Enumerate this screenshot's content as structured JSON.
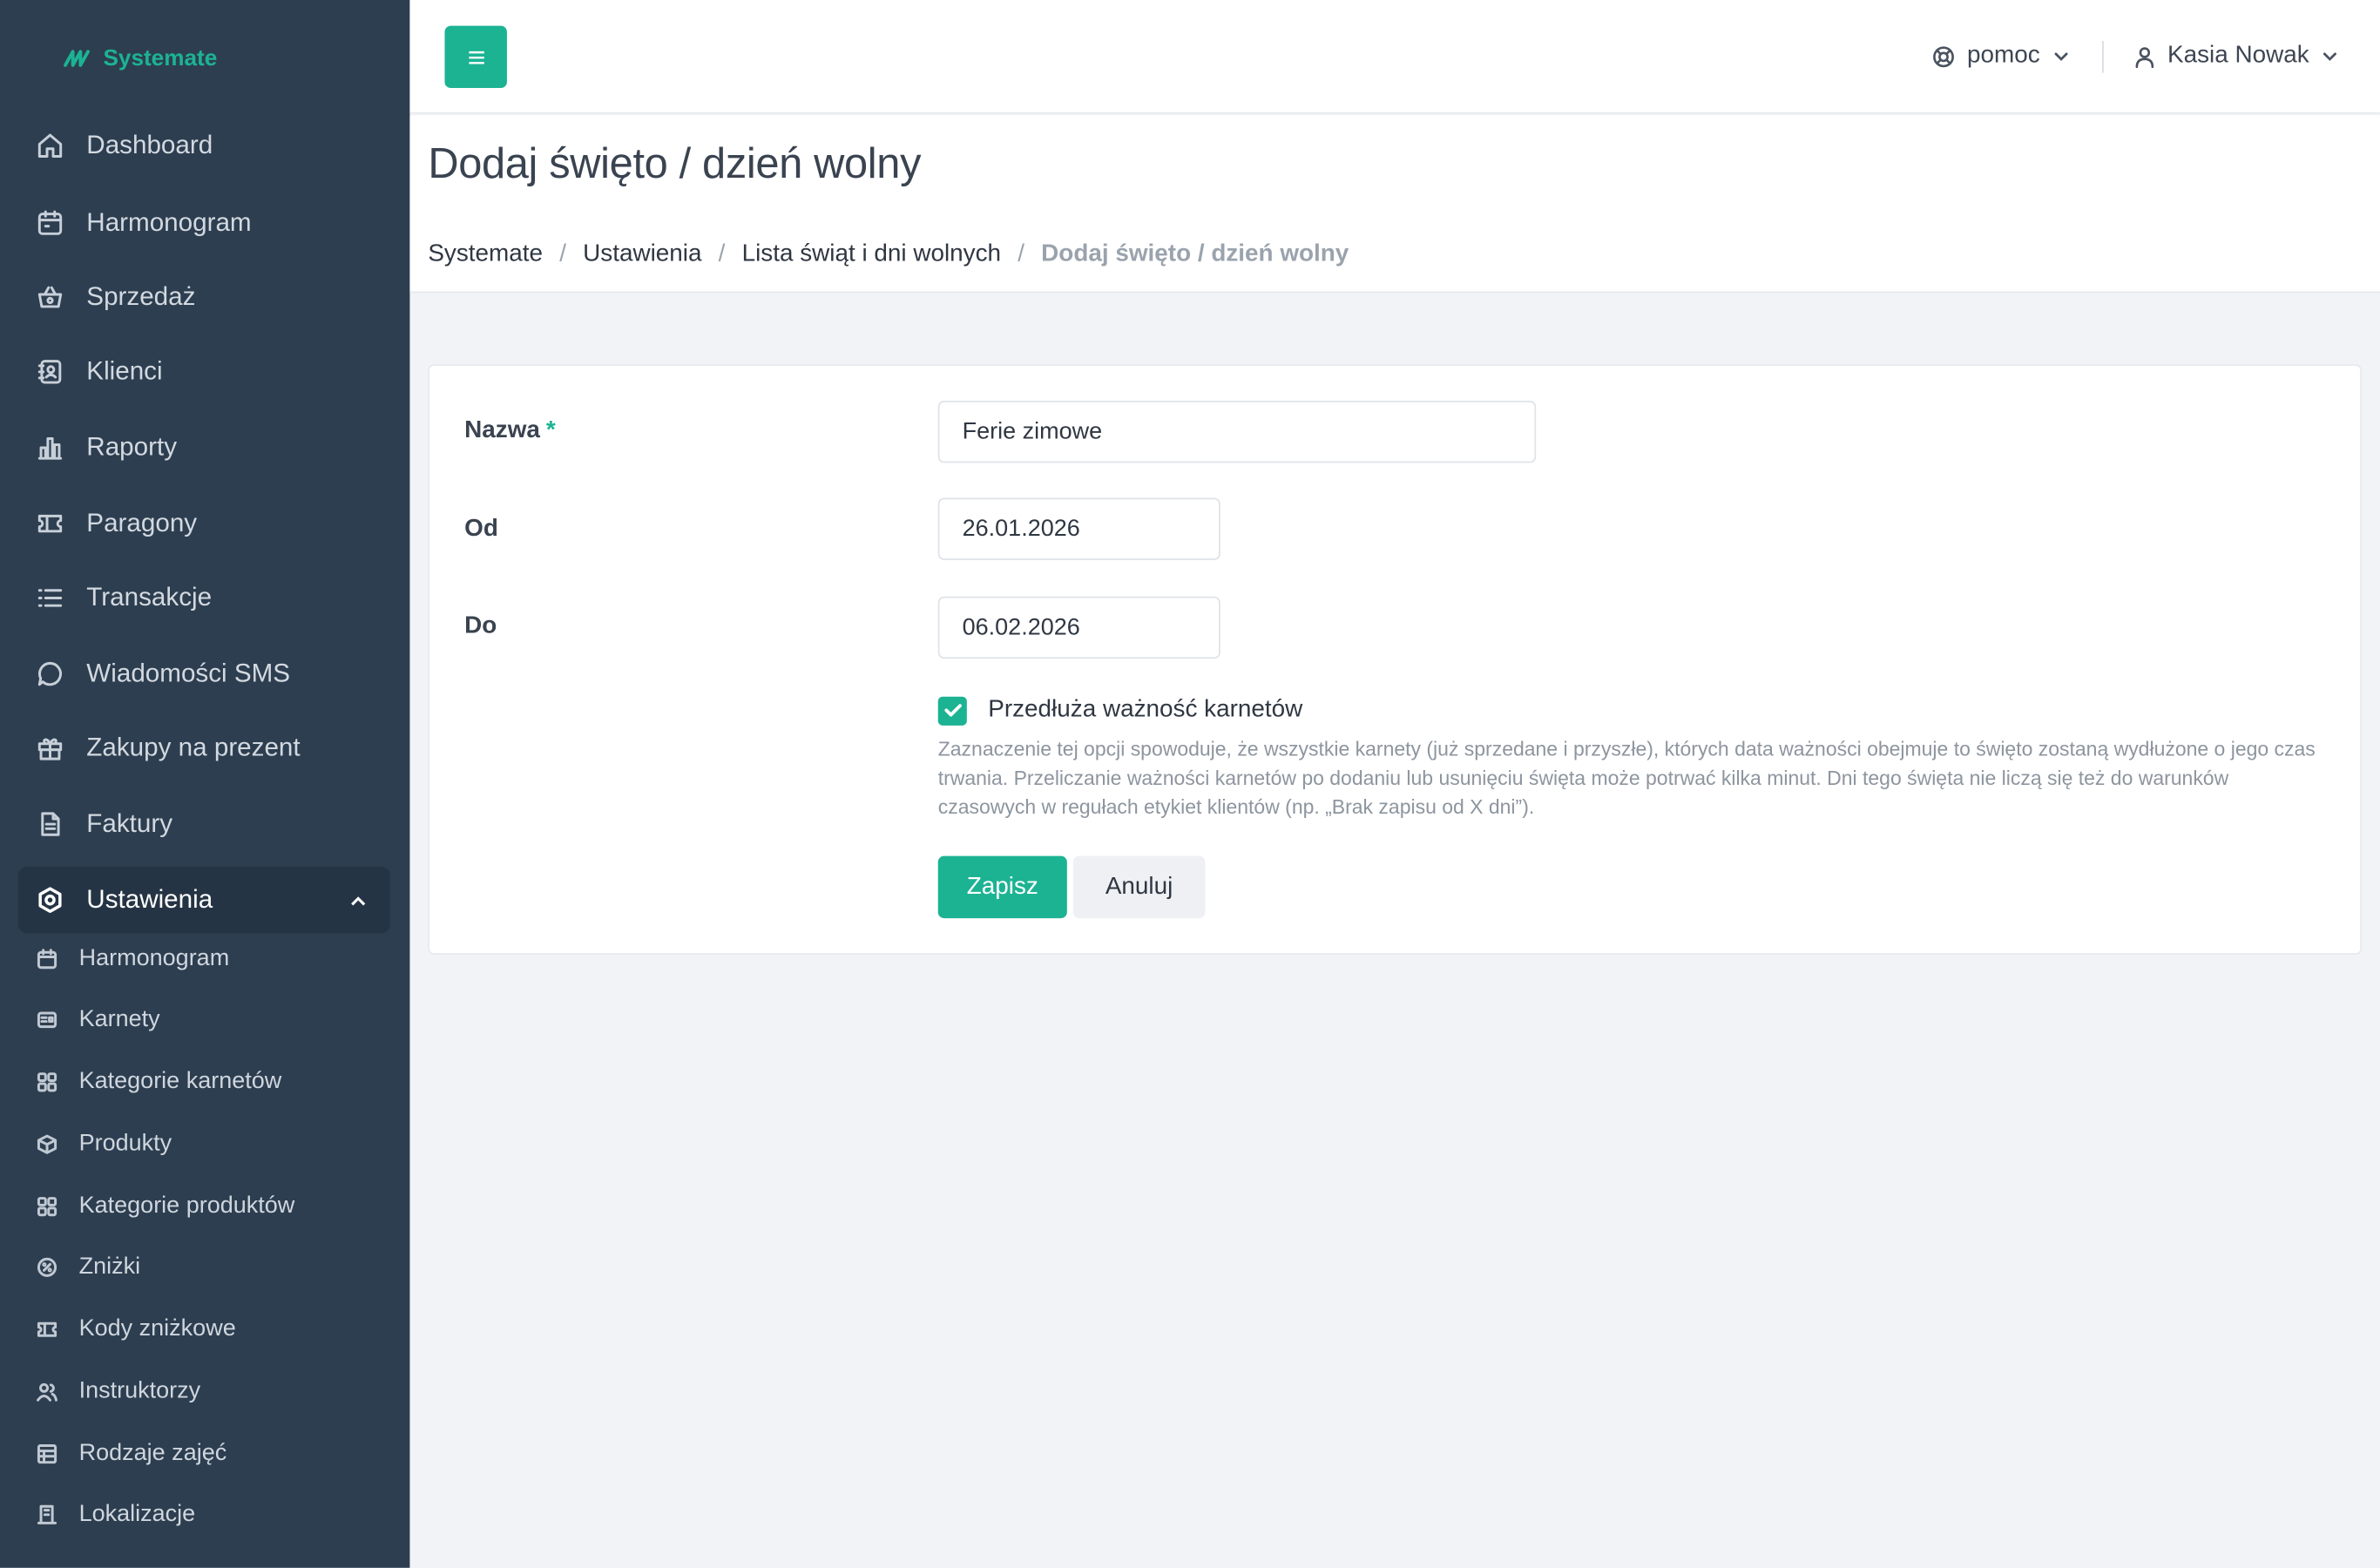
{
  "brand": {
    "name": "Systemate"
  },
  "sidebar": {
    "items": [
      {
        "label": "Dashboard",
        "icon": "home-icon"
      },
      {
        "label": "Harmonogram",
        "icon": "calendar-icon"
      },
      {
        "label": "Sprzedaż",
        "icon": "basket-icon"
      },
      {
        "label": "Klienci",
        "icon": "address-book-icon"
      },
      {
        "label": "Raporty",
        "icon": "bar-chart-icon"
      },
      {
        "label": "Paragony",
        "icon": "ticket-icon"
      },
      {
        "label": "Transakcje",
        "icon": "list-icon"
      },
      {
        "label": "Wiadomości SMS",
        "icon": "chat-bubble-icon"
      },
      {
        "label": "Zakupy na prezent",
        "icon": "gift-icon"
      },
      {
        "label": "Faktury",
        "icon": "document-icon"
      },
      {
        "label": "Ustawienia",
        "icon": "settings-hexagon-icon",
        "active": true
      }
    ],
    "subitems": [
      {
        "label": "Harmonogram",
        "icon": "calendar-icon"
      },
      {
        "label": "Karnety",
        "icon": "id-card-icon"
      },
      {
        "label": "Kategorie karnetów",
        "icon": "grid-icon"
      },
      {
        "label": "Produkty",
        "icon": "cube-icon"
      },
      {
        "label": "Kategorie produktów",
        "icon": "grid-icon"
      },
      {
        "label": "Zniżki",
        "icon": "percent-icon"
      },
      {
        "label": "Kody zniżkowe",
        "icon": "ticket-icon"
      },
      {
        "label": "Instruktorzy",
        "icon": "users-icon"
      },
      {
        "label": "Rodzaje zajęć",
        "icon": "layers-icon"
      },
      {
        "label": "Lokalizacje",
        "icon": "building-icon"
      }
    ]
  },
  "topbar": {
    "help_label": "pomoc",
    "user_name": "Kasia Nowak"
  },
  "header": {
    "title": "Dodaj święto / dzień wolny",
    "breadcrumb": [
      "Systemate",
      "Ustawienia",
      "Lista świąt i dni wolnych",
      "Dodaj święto / dzień wolny"
    ]
  },
  "form": {
    "name_label": "Nazwa",
    "name_required": "*",
    "name_value": "Ferie zimowe",
    "from_label": "Od",
    "from_value": "26.01.2026",
    "to_label": "Do",
    "to_value": "06.02.2026",
    "extend_label": "Przedłuża ważność karnetów",
    "extend_checked": true,
    "extend_help": "Zaznaczenie tej opcji spowoduje, że wszystkie karnety (już sprzedane i przyszłe), których data ważności obejmuje to święto zostaną wydłużone o jego czas trwania. Przeliczanie ważności karnetów po dodaniu lub usunięciu święta może potrwać kilka minut. Dni tego święta nie liczą się też do warunków czasowych w regułach etykiet klientów (np. „Brak zapisu od X dni”).",
    "save_label": "Zapisz",
    "cancel_label": "Anuluj"
  },
  "colors": {
    "accent": "#1cb393",
    "sidebar_bg": "#2d3e50",
    "page_bg": "#f1f3f6"
  }
}
